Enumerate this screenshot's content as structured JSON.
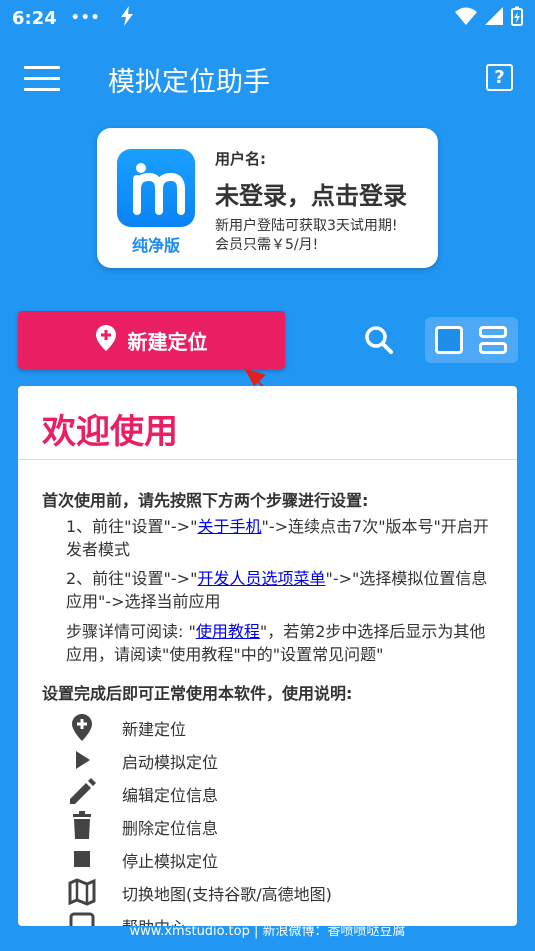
{
  "status_bar": {
    "time": "6:24",
    "dots": "•••"
  },
  "header": {
    "title": "模拟定位助手"
  },
  "user_card": {
    "edition": "纯净版",
    "username_label": "用户名:",
    "login_prompt": "未登录，点击登录",
    "trial_line1": "新用户登陆可获取3天试用期!",
    "trial_line2": "会员只需￥5/月!"
  },
  "actions": {
    "new_location_label": "新建定位"
  },
  "welcome": {
    "title": "欢迎使用",
    "intro": "首次使用前，请先按照下方两个步骤进行设置:",
    "step1_pre": "1、前往\"设置\"->\"",
    "step1_link": "关于手机",
    "step1_post": "\"->连续点击7次\"版本号\"开启开发者模式",
    "step2_pre": "2、前往\"设置\"->\"",
    "step2_link": "开发人员选项菜单",
    "step2_post": "\"->\"选择模拟位置信息应用\"->选择当前应用",
    "step3_pre": "步骤详情可阅读: \"",
    "step3_link": "使用教程",
    "step3_post": "\"，若第2步中选择后显示为其他应用，请阅读\"使用教程\"中的\"设置常见问题\"",
    "usage_title": "设置完成后即可正常使用本软件，使用说明:",
    "usage_items": [
      {
        "label": "新建定位",
        "icon": "location-add-icon"
      },
      {
        "label": "启动模拟定位",
        "icon": "play-icon"
      },
      {
        "label": "编辑定位信息",
        "icon": "pencil-icon"
      },
      {
        "label": "删除定位信息",
        "icon": "trash-icon"
      },
      {
        "label": "停止模拟定位",
        "icon": "stop-icon"
      },
      {
        "label": "切换地图(支持谷歌/高德地图)",
        "icon": "map-icon"
      },
      {
        "label": "帮助中心",
        "icon": "help-icon"
      }
    ]
  },
  "footer": {
    "text": "www.xmstudio.top  |  新浪微博：香喷喷哒豆腐"
  },
  "colors": {
    "primary": "#2196F3",
    "accent": "#E91E63",
    "link": "#0000EE"
  }
}
